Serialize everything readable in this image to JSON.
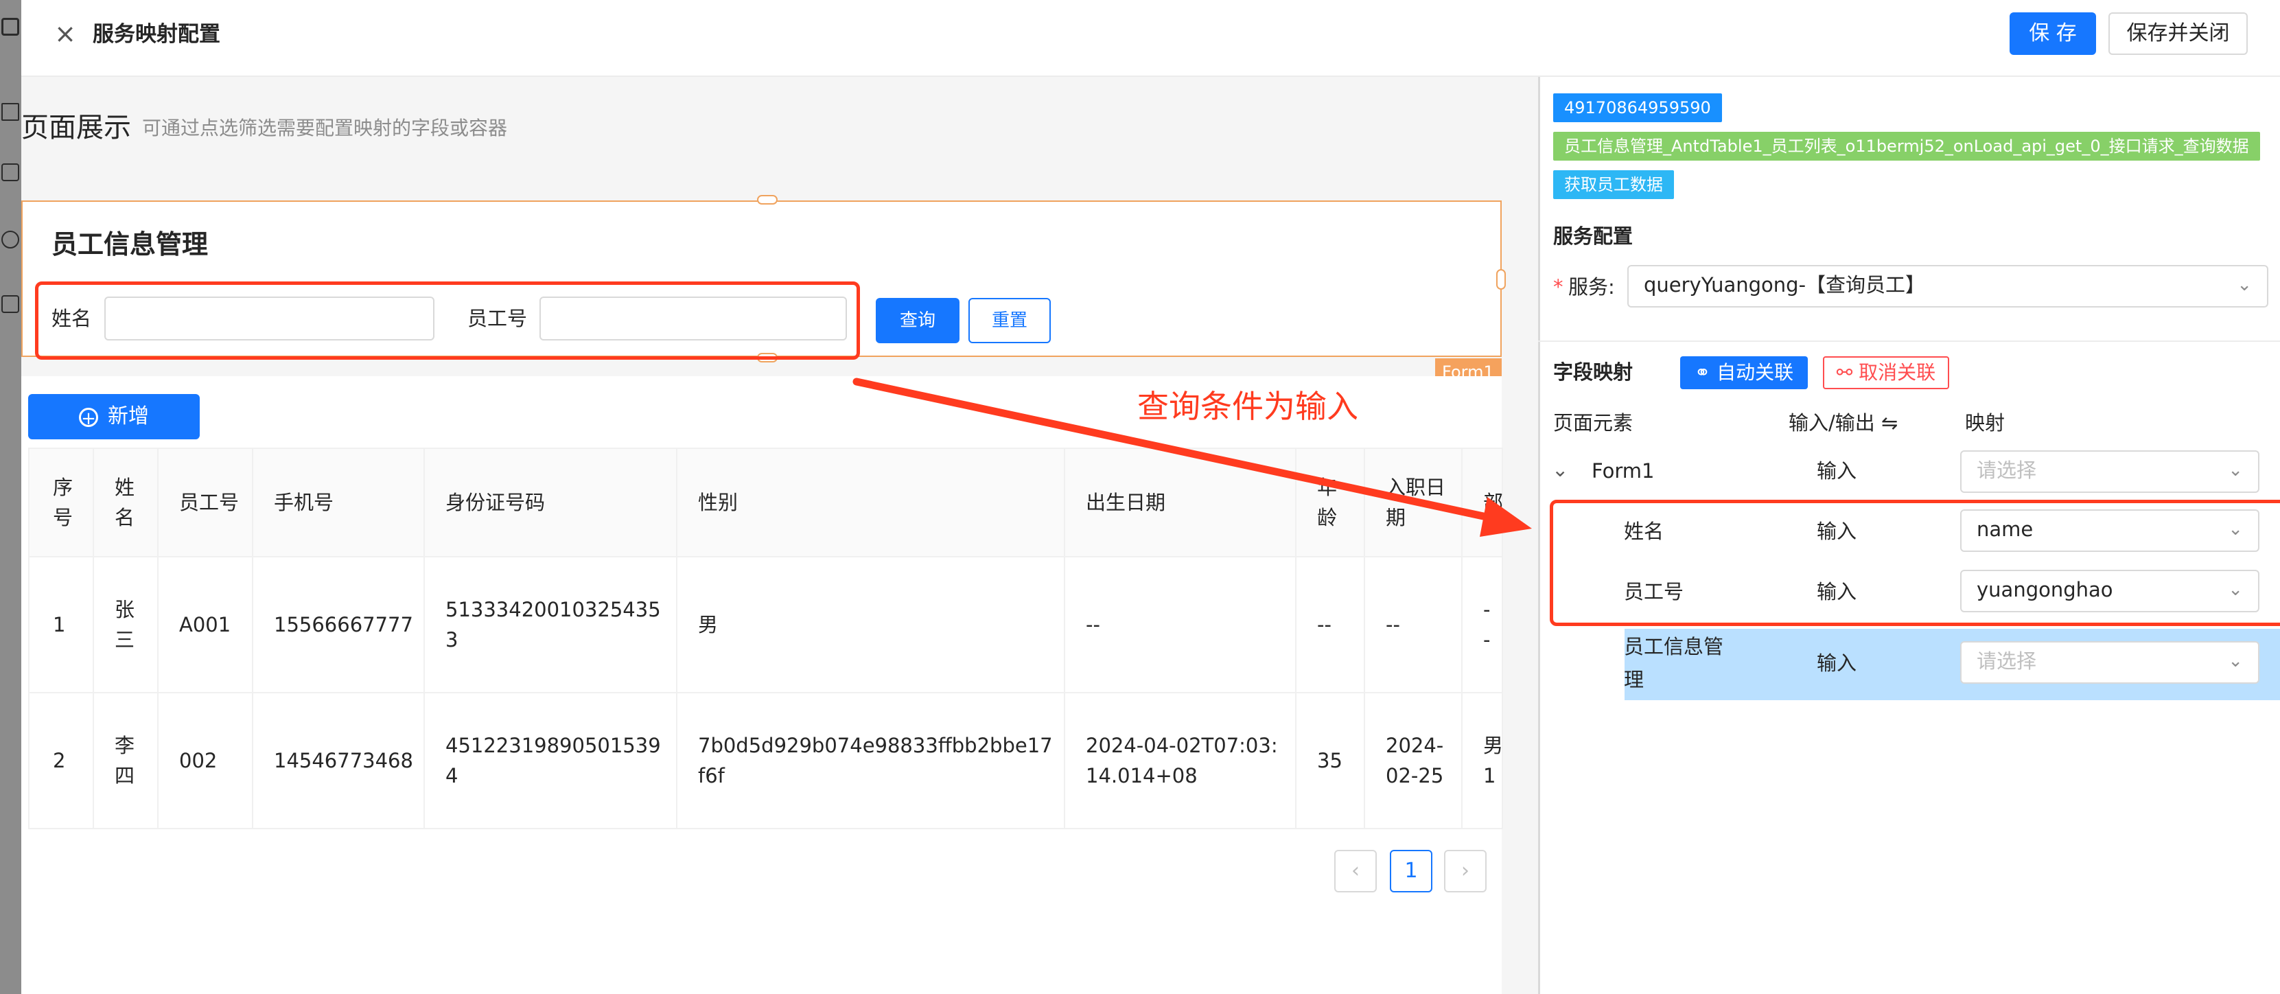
{
  "header": {
    "close_glyph": "×",
    "title": "服务映射配置",
    "save_label": "保 存",
    "save_close_label": "保存并关闭"
  },
  "left": {
    "heading": "页面展示",
    "hint": "可通过点选筛选需要配置映射的字段或容器",
    "form_title": "员工信息管理",
    "form_tag": "Form1",
    "fields": [
      {
        "label": "姓名",
        "value": ""
      },
      {
        "label": "员工号",
        "value": ""
      }
    ],
    "query_label": "查询",
    "reset_label": "重置",
    "add_label": "新增",
    "add_glyph": "+",
    "table": {
      "headers": [
        "序号",
        "姓名",
        "员工号",
        "手机号",
        "身份证号码",
        "性别",
        "出生日期",
        "年龄",
        "入职日期",
        "部"
      ],
      "rows": [
        [
          "1",
          "张三",
          "A001",
          "15566667777",
          "513334200103254353",
          "男",
          "--",
          "--",
          "--",
          "--"
        ],
        [
          "2",
          "李四",
          "002",
          "14546773468",
          "451223198905015394",
          "7b0d5d929b074e98833ffbb2bbe17f6f",
          "2024-04-02T07:03:14.014+08",
          "35",
          "2024-02-25",
          "男1"
        ]
      ]
    },
    "pagination": {
      "prev": "‹",
      "current": "1",
      "next": "›"
    }
  },
  "annotation": {
    "text": "查询条件为输入",
    "color": "#ff3b1f"
  },
  "right": {
    "tags": [
      {
        "text": "49170864959590",
        "color": "#1890ff"
      },
      {
        "text": "员工信息管理_AntdTable1_员工列表_o11bermj52_onLoad_api_get_0_接口请求_查询数据",
        "color": "#87d068"
      },
      {
        "text": "获取员工数据",
        "color": "#2db7f5"
      }
    ],
    "service_section_title": "服务配置",
    "service_required_mark": "*",
    "service_label": "服务:",
    "service_value": "queryYuangong-【查询员工】",
    "mapping_title": "字段映射",
    "auto_link_label": "自动关联",
    "cancel_link_label": "取消关联",
    "columns": {
      "element": "页面元素",
      "io": "输入/输出 ⇋",
      "mapping": "映射"
    },
    "tree": [
      {
        "name": "Form1",
        "io": "输入",
        "mapping": "",
        "placeholder": "请选择",
        "expand_glyph": "⌄"
      },
      {
        "name": "姓名",
        "io": "输入",
        "mapping": "name",
        "placeholder": "请选择"
      },
      {
        "name": "员工号",
        "io": "输入",
        "mapping": "yuangonghao",
        "placeholder": "请选择"
      },
      {
        "name": "员工信息管理",
        "io": "输入",
        "mapping": "",
        "placeholder": "请选择"
      }
    ]
  },
  "colors": {
    "primary": "#1677ff",
    "danger": "#ff4d4f",
    "form_outline": "#f0a35e",
    "highlight_row": "#bae0ff"
  },
  "icons": {
    "close": "close-icon",
    "plus": "plus-circle-icon",
    "link": "link-icon",
    "unlink": "disconnect-icon",
    "chevron": "chevron-down-icon"
  }
}
